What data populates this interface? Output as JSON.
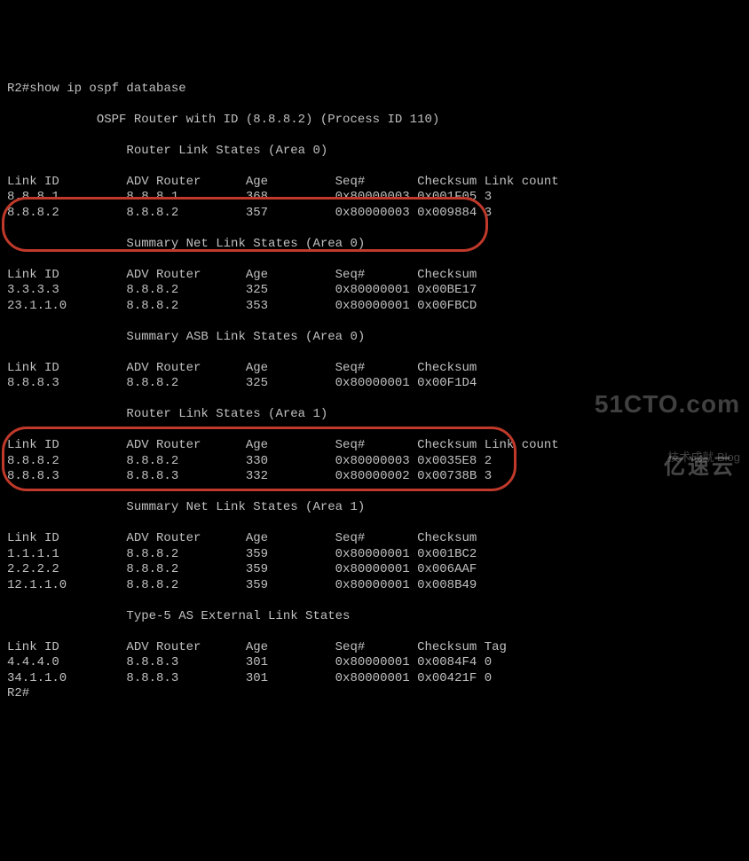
{
  "prompt": "R2#",
  "command": "show ip ospf database",
  "header_line1": "            OSPF Router with ID (8.8.8.2) (Process ID 110)",
  "sections": [
    {
      "title": "                Router Link States (Area 0)",
      "cols_header": "Link ID         ADV Router      Age         Seq#       Checksum Link count",
      "rows": [
        "8.8.8.1         8.8.8.1         368         0x80000003 0x001F05 3",
        "8.8.8.2         8.8.8.2         357         0x80000003 0x009884 3"
      ]
    },
    {
      "title": "                Summary Net Link States (Area 0)",
      "cols_header": "Link ID         ADV Router      Age         Seq#       Checksum",
      "rows": [
        "3.3.3.3         8.8.8.2         325         0x80000001 0x00BE17",
        "23.1.1.0        8.8.8.2         353         0x80000001 0x00FBCD"
      ]
    },
    {
      "title": "                Summary ASB Link States (Area 0)",
      "cols_header": "Link ID         ADV Router      Age         Seq#       Checksum",
      "rows": [
        "8.8.8.3         8.8.8.2         325         0x80000001 0x00F1D4"
      ]
    },
    {
      "title": "                Router Link States (Area 1)",
      "cols_header": "Link ID         ADV Router      Age         Seq#       Checksum Link count",
      "rows": [
        "8.8.8.2         8.8.8.2         330         0x80000003 0x0035E8 2",
        "8.8.8.3         8.8.8.3         332         0x80000002 0x00738B 3"
      ]
    },
    {
      "title": "                Summary Net Link States (Area 1)",
      "cols_header": "Link ID         ADV Router      Age         Seq#       Checksum",
      "rows": [
        "1.1.1.1         8.8.8.2         359         0x80000001 0x001BC2",
        "2.2.2.2         8.8.8.2         359         0x80000001 0x006AAF",
        "12.1.1.0        8.8.8.2         359         0x80000001 0x008B49"
      ]
    },
    {
      "title": "                Type-5 AS External Link States",
      "cols_header": "Link ID         ADV Router      Age         Seq#       Checksum Tag",
      "rows": [
        "4.4.4.0         8.8.8.3         301         0x80000001 0x0084F4 0",
        "34.1.1.0        8.8.8.3         301         0x80000001 0x00421F 0"
      ]
    }
  ],
  "end_prompt": "R2#",
  "watermark": {
    "big": "51CTO.com",
    "small": "技术成就 Blog",
    "brand": "亿速云"
  }
}
